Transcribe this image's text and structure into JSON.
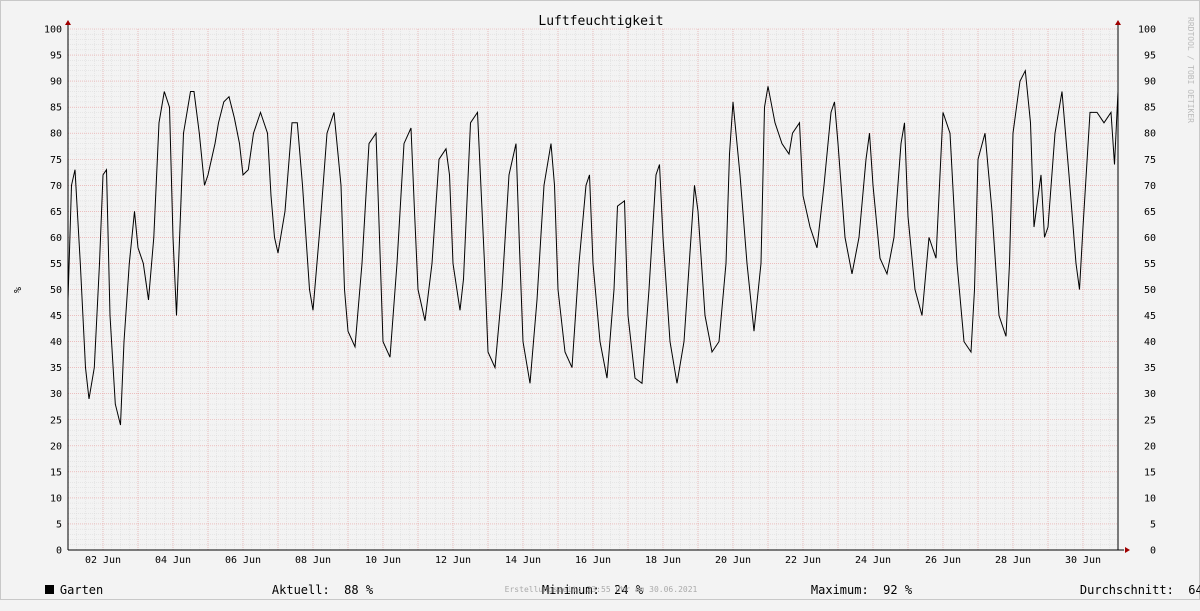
{
  "chart_data": {
    "type": "line",
    "title": "Luftfeuchtigkeit",
    "ylabel": "%",
    "ylim": [
      0,
      100
    ],
    "yticks": [
      0,
      5,
      10,
      15,
      20,
      25,
      30,
      35,
      40,
      45,
      50,
      55,
      60,
      65,
      70,
      75,
      80,
      85,
      90,
      95,
      100
    ],
    "xlim": [
      1,
      31
    ],
    "xticks": [
      {
        "day": 2,
        "label": "02 Jun"
      },
      {
        "day": 4,
        "label": "04 Jun"
      },
      {
        "day": 6,
        "label": "06 Jun"
      },
      {
        "day": 8,
        "label": "08 Jun"
      },
      {
        "day": 10,
        "label": "10 Jun"
      },
      {
        "day": 12,
        "label": "12 Jun"
      },
      {
        "day": 14,
        "label": "14 Jun"
      },
      {
        "day": 16,
        "label": "16 Jun"
      },
      {
        "day": 18,
        "label": "18 Jun"
      },
      {
        "day": 20,
        "label": "20 Jun"
      },
      {
        "day": 22,
        "label": "22 Jun"
      },
      {
        "day": 24,
        "label": "24 Jun"
      },
      {
        "day": 26,
        "label": "26 Jun"
      },
      {
        "day": 28,
        "label": "28 Jun"
      },
      {
        "day": 30,
        "label": "30 Jun"
      }
    ],
    "grid": true,
    "series": [
      {
        "name": "Garten",
        "color": "#000000",
        "x": [
          1.0,
          1.1,
          1.2,
          1.35,
          1.5,
          1.6,
          1.75,
          1.9,
          2.0,
          2.1,
          2.2,
          2.35,
          2.5,
          2.6,
          2.75,
          2.9,
          3.0,
          3.15,
          3.3,
          3.45,
          3.6,
          3.75,
          3.9,
          4.0,
          4.1,
          4.2,
          4.3,
          4.5,
          4.6,
          4.75,
          4.9,
          5.0,
          5.2,
          5.3,
          5.45,
          5.6,
          5.75,
          5.9,
          6.0,
          6.15,
          6.3,
          6.5,
          6.7,
          6.8,
          6.9,
          7.0,
          7.2,
          7.4,
          7.55,
          7.7,
          7.9,
          8.0,
          8.2,
          8.4,
          8.6,
          8.8,
          8.9,
          9.0,
          9.2,
          9.4,
          9.6,
          9.8,
          9.9,
          10.0,
          10.2,
          10.4,
          10.6,
          10.8,
          10.9,
          11.0,
          11.2,
          11.4,
          11.6,
          11.8,
          11.9,
          12.0,
          12.2,
          12.3,
          12.5,
          12.7,
          12.9,
          13.0,
          13.2,
          13.4,
          13.6,
          13.8,
          13.9,
          14.0,
          14.2,
          14.4,
          14.6,
          14.8,
          14.9,
          15.0,
          15.2,
          15.4,
          15.6,
          15.8,
          15.9,
          16.0,
          16.2,
          16.4,
          16.6,
          16.7,
          16.9,
          17.0,
          17.2,
          17.4,
          17.6,
          17.8,
          17.9,
          18.0,
          18.2,
          18.4,
          18.6,
          18.8,
          18.9,
          19.0,
          19.2,
          19.4,
          19.6,
          19.8,
          19.9,
          20.0,
          20.2,
          20.4,
          20.6,
          20.8,
          20.9,
          21.0,
          21.2,
          21.4,
          21.6,
          21.7,
          21.9,
          22.0,
          22.2,
          22.4,
          22.6,
          22.8,
          22.9,
          23.0,
          23.2,
          23.4,
          23.6,
          23.8,
          23.9,
          24.0,
          24.2,
          24.4,
          24.6,
          24.8,
          24.9,
          25.0,
          25.2,
          25.4,
          25.6,
          25.8,
          25.9,
          26.0,
          26.2,
          26.4,
          26.6,
          26.8,
          26.9,
          27.0,
          27.2,
          27.4,
          27.6,
          27.8,
          27.9,
          28.0,
          28.2,
          28.35,
          28.5,
          28.6,
          28.8,
          28.9,
          29.0,
          29.2,
          29.4,
          29.6,
          29.8,
          29.9,
          30.0,
          30.2,
          30.4,
          30.6,
          30.8,
          30.9,
          31.0
        ],
        "y": [
          48,
          70,
          73,
          55,
          35,
          29,
          35,
          55,
          72,
          73,
          45,
          28,
          24,
          40,
          55,
          65,
          58,
          55,
          48,
          60,
          82,
          88,
          85,
          60,
          45,
          62,
          80,
          88,
          88,
          80,
          70,
          72,
          78,
          82,
          86,
          87,
          83,
          78,
          72,
          73,
          80,
          84,
          80,
          68,
          60,
          57,
          65,
          82,
          82,
          70,
          50,
          46,
          62,
          80,
          84,
          70,
          50,
          42,
          39,
          55,
          78,
          80,
          60,
          40,
          37,
          55,
          78,
          81,
          65,
          50,
          44,
          55,
          75,
          77,
          72,
          55,
          46,
          52,
          82,
          84,
          55,
          38,
          35,
          50,
          72,
          78,
          58,
          40,
          32,
          48,
          70,
          78,
          70,
          50,
          38,
          35,
          55,
          70,
          72,
          55,
          40,
          33,
          50,
          66,
          67,
          45,
          33,
          32,
          50,
          72,
          74,
          60,
          40,
          32,
          40,
          60,
          70,
          65,
          45,
          38,
          40,
          55,
          76,
          86,
          72,
          55,
          42,
          55,
          85,
          89,
          82,
          78,
          76,
          80,
          82,
          68,
          62,
          58,
          70,
          84,
          86,
          78,
          60,
          53,
          60,
          75,
          80,
          70,
          56,
          53,
          60,
          78,
          82,
          64,
          50,
          45,
          60,
          56,
          70,
          84,
          80,
          55,
          40,
          38,
          50,
          75,
          80,
          65,
          45,
          41,
          55,
          80,
          90,
          92,
          82,
          62,
          72,
          60,
          62,
          80,
          88,
          72,
          55,
          50,
          62,
          84,
          84,
          82,
          84,
          74,
          88
        ]
      }
    ],
    "legend": {
      "series_label": "Garten",
      "current_label": "Aktuell:",
      "current_value": "88 %",
      "min_label": "Minimum:",
      "min_value": "24 %",
      "max_label": "Maximum:",
      "max_value": "92 %",
      "avg_label": "Durchschnitt:",
      "avg_value": "64 %"
    },
    "side_credit": "RRDTOOL / TOBI OETIKER",
    "footer": "Erstellungszeit: 23:55 Uhr am 30.06.2021"
  }
}
